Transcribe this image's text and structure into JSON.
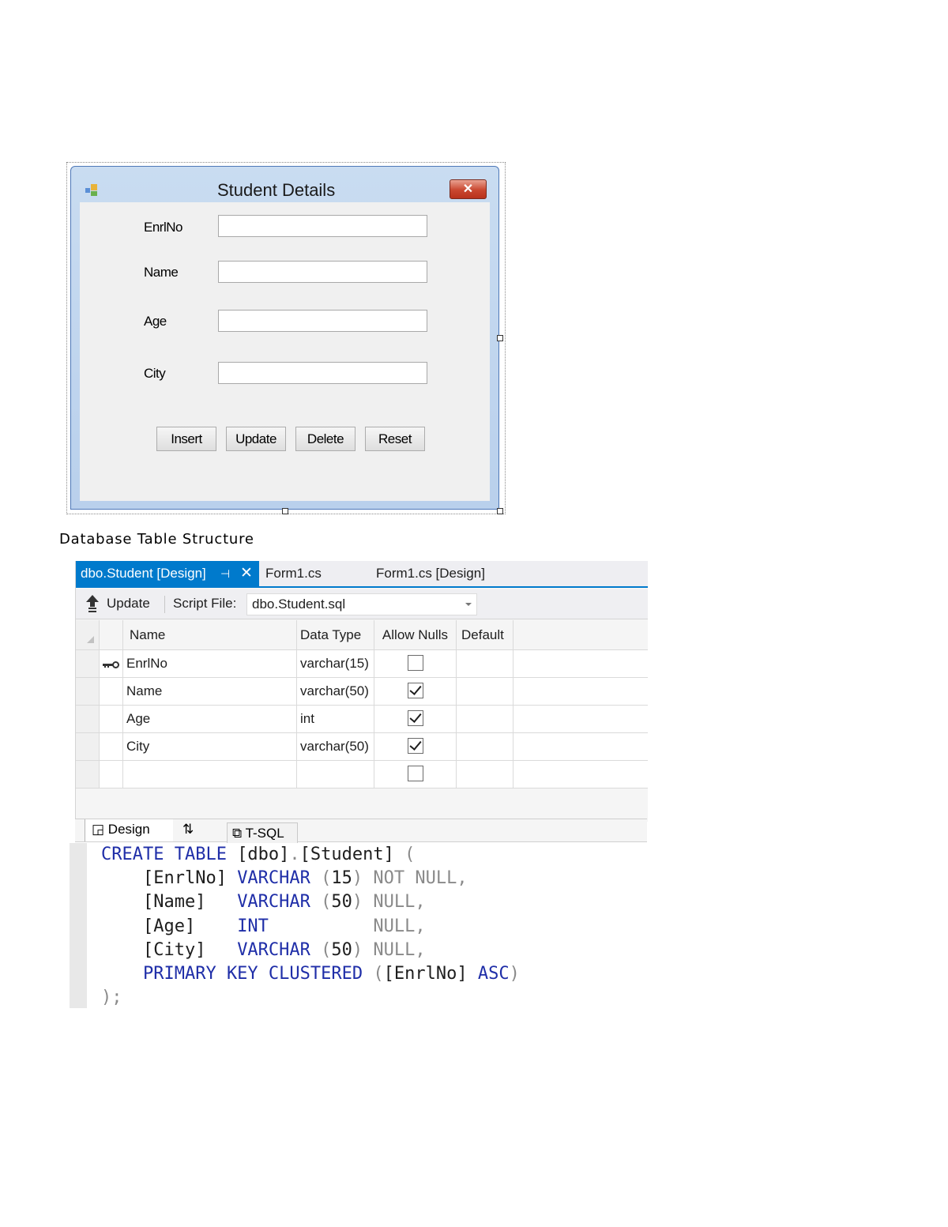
{
  "form": {
    "title": "Student Details",
    "close_glyph": "✕",
    "icon": "app-form-icon",
    "fields": [
      {
        "label": "EnrlNo",
        "value": ""
      },
      {
        "label": "Name",
        "value": ""
      },
      {
        "label": "Age",
        "value": ""
      },
      {
        "label": "City",
        "value": ""
      }
    ],
    "buttons": [
      "Insert",
      "Update",
      "Delete",
      "Reset"
    ]
  },
  "caption": "Database Table Structure",
  "vs": {
    "tabs": [
      {
        "label": "dbo.Student [Design]",
        "active": true,
        "pin_glyph": "⊣",
        "close_glyph": "✕"
      },
      {
        "label": "Form1.cs",
        "active": false
      },
      {
        "label": "Form1.cs [Design]",
        "active": false
      }
    ],
    "accent_color": "#007acc",
    "toolbar": {
      "update_label": "Update",
      "script_file_label": "Script File:",
      "script_file_value": "dbo.Student.sql"
    },
    "grid": {
      "headers": [
        "Name",
        "Data Type",
        "Allow Nulls",
        "Default"
      ],
      "rows": [
        {
          "key": true,
          "name": "EnrlNo",
          "type": "varchar(15)",
          "allow_nulls": false,
          "default": ""
        },
        {
          "key": false,
          "name": "Name",
          "type": "varchar(50)",
          "allow_nulls": true,
          "default": ""
        },
        {
          "key": false,
          "name": "Age",
          "type": "int",
          "allow_nulls": true,
          "default": ""
        },
        {
          "key": false,
          "name": "City",
          "type": "varchar(50)",
          "allow_nulls": true,
          "default": ""
        },
        {
          "key": false,
          "name": "",
          "type": "",
          "allow_nulls": false,
          "default": ""
        }
      ]
    },
    "bottom_tabs": {
      "design": "Design",
      "swap_glyph": "⇅",
      "tsql": "T-SQL"
    },
    "sql_lines": [
      [
        {
          "t": "CREATE TABLE ",
          "c": "kw"
        },
        {
          "t": "[dbo]",
          "c": ""
        },
        {
          "t": ".",
          "c": "gr"
        },
        {
          "t": "[Student] ",
          "c": ""
        },
        {
          "t": "(",
          "c": "gr"
        }
      ],
      [
        {
          "t": "    [EnrlNo] ",
          "c": ""
        },
        {
          "t": "VARCHAR ",
          "c": "kw"
        },
        {
          "t": "(",
          "c": "gr"
        },
        {
          "t": "15",
          "c": ""
        },
        {
          "t": ") ",
          "c": "gr"
        },
        {
          "t": "NOT NULL,",
          "c": "gr"
        }
      ],
      [
        {
          "t": "    [Name]   ",
          "c": ""
        },
        {
          "t": "VARCHAR ",
          "c": "kw"
        },
        {
          "t": "(",
          "c": "gr"
        },
        {
          "t": "50",
          "c": ""
        },
        {
          "t": ") ",
          "c": "gr"
        },
        {
          "t": "NULL,",
          "c": "gr"
        }
      ],
      [
        {
          "t": "    [Age]    ",
          "c": ""
        },
        {
          "t": "INT          ",
          "c": "kw"
        },
        {
          "t": "NULL,",
          "c": "gr"
        }
      ],
      [
        {
          "t": "    [City]   ",
          "c": ""
        },
        {
          "t": "VARCHAR ",
          "c": "kw"
        },
        {
          "t": "(",
          "c": "gr"
        },
        {
          "t": "50",
          "c": ""
        },
        {
          "t": ") ",
          "c": "gr"
        },
        {
          "t": "NULL,",
          "c": "gr"
        }
      ],
      [
        {
          "t": "    PRIMARY KEY CLUSTERED ",
          "c": "kw"
        },
        {
          "t": "(",
          "c": "gr"
        },
        {
          "t": "[EnrlNo] ",
          "c": ""
        },
        {
          "t": "ASC",
          "c": "kw"
        },
        {
          "t": ")",
          "c": "gr"
        }
      ],
      [
        {
          "t": ");",
          "c": "gr"
        }
      ]
    ]
  }
}
